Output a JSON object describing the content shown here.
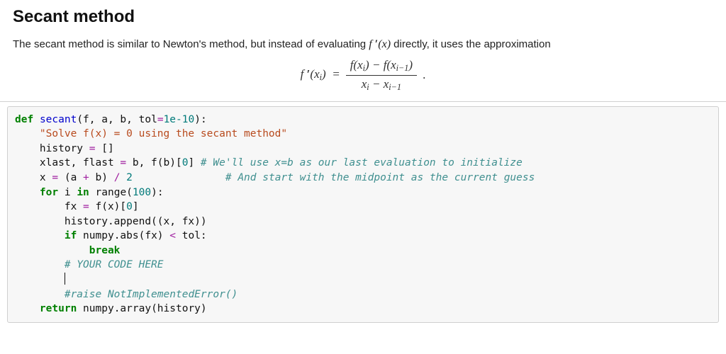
{
  "heading": "Secant method",
  "description_prefix": "The secant method is similar to Newton's method, but instead of evaluating ",
  "description_math1": "f ′(x)",
  "description_suffix": " directly, it uses the approximation",
  "equation": {
    "lhs": "f ′(x_i) =",
    "num": "f(x_i) − f(x_{i−1})",
    "den": "x_i − x_{i−1}",
    "trail": "."
  },
  "code": {
    "def": "def",
    "fn_name": "secant",
    "sig_open": "(f, a, b, tol",
    "sig_eq": "=",
    "sig_tol": "1e-10",
    "sig_close": "):",
    "docstring": "\"Solve f(x) = 0 using the secant method\"",
    "hist_lhs": "    history ",
    "op_eq": "=",
    "hist_rhs": " []",
    "xlast_lhs": "    xlast, flast ",
    "xlast_rhs": " b, f(b)[",
    "zero": "0",
    "xlast_close": "] ",
    "cmt1": "# We'll use x=b as our last evaluation to initialize",
    "x_lhs": "    x ",
    "x_rhs": " (a ",
    "plus": "+",
    "x_rhs2": " b) ",
    "div": "/",
    "two": " 2",
    "pad2": "               ",
    "cmt2": "# And start with the midpoint as the current guess",
    "for": "for",
    "for_rest": " i ",
    "in": "in",
    "range": " range(",
    "hundred": "100",
    "range_close": "):",
    "fx_lhs": "        fx ",
    "fx_rhs": " f(x)[",
    "fx_close": "]",
    "append": "        history.append((x, fx))",
    "if": "if",
    "if_rest": " numpy.abs(fx) ",
    "lt": "<",
    "tol_rhs": " tol:",
    "break": "break",
    "cmt3": "# YOUR CODE HERE",
    "cursor_indent": "        ",
    "cmt4": "#raise NotImplementedError()",
    "return": "return",
    "return_rhs": " numpy.array(history)"
  }
}
